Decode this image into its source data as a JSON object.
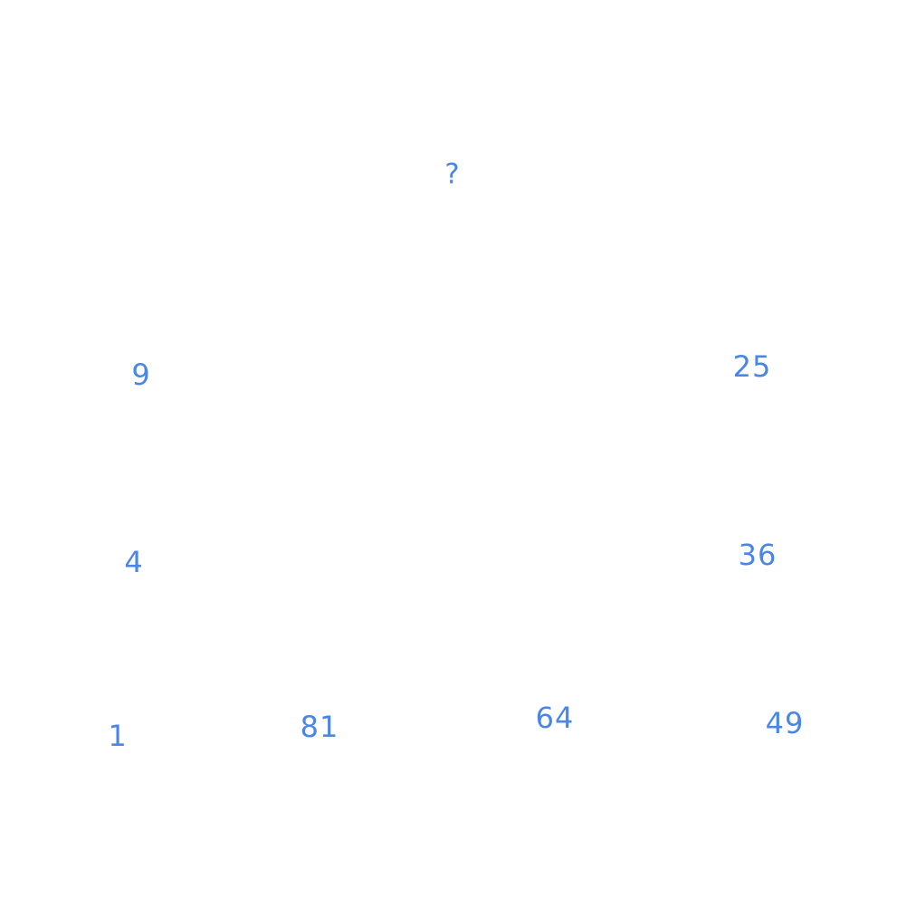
{
  "text_color": "#4a86e8",
  "background": "#ffffff",
  "numbers": {
    "unknown": "?",
    "n9": "9",
    "n25": "25",
    "n4": "4",
    "n36": "36",
    "n1": "1",
    "n81": "81",
    "n64": "64",
    "n49": "49"
  }
}
